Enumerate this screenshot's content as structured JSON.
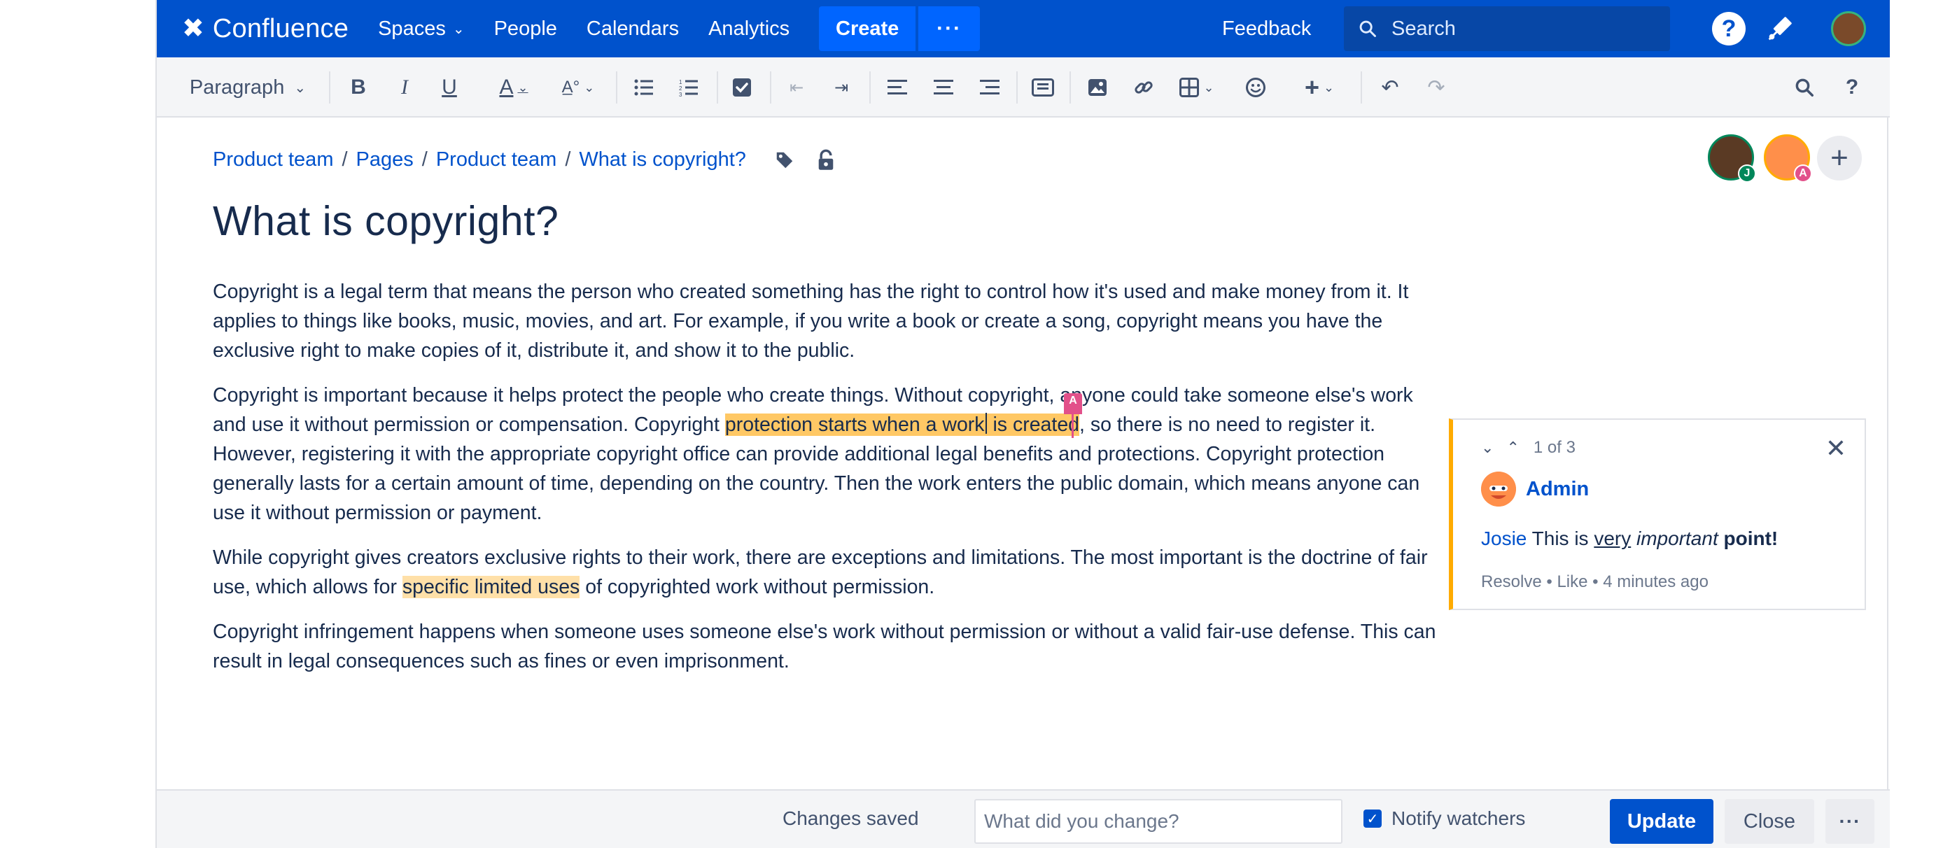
{
  "topnav": {
    "brand": "Confluence",
    "items": [
      {
        "label": "Spaces",
        "has_dropdown": true
      },
      {
        "label": "People"
      },
      {
        "label": "Calendars"
      },
      {
        "label": "Analytics"
      }
    ],
    "create_label": "Create",
    "more_label": "···",
    "feedback_label": "Feedback",
    "search_placeholder": "Search",
    "help_label": "?",
    "brand_color": "#0052cc"
  },
  "toolbar": {
    "paragraph_style": "Paragraph",
    "bold": "B",
    "italic": "I",
    "underline": "U",
    "text_color": "A",
    "icons": [
      "text-style",
      "bullet-list",
      "numbered-list",
      "task-list",
      "outdent",
      "indent",
      "align-left",
      "align-center",
      "align-right",
      "page-layout",
      "image",
      "link",
      "table",
      "emoji",
      "insert-more",
      "undo",
      "redo",
      "find",
      "help"
    ]
  },
  "breadcrumb": [
    "Product team",
    "Pages",
    "Product team",
    "What is copyright?"
  ],
  "collaborators": [
    {
      "initial": "J",
      "badge_color": "#00875a",
      "avatar_color": "#5a3a24"
    },
    {
      "initial": "A",
      "badge_color": "#e2508a",
      "avatar_color": "#ff8f4a"
    }
  ],
  "page": {
    "title": "What is copyright?",
    "paragraphs": {
      "p1": "Copyright is a legal term that means the person who created something has the right to control how it's used and make money from it. It applies to things like books, music, movies, and art. For example, if you write a book or create a song, copyright means you have the exclusive right to make copies of it, distribute it, and show it to the public.",
      "p2_before": "Copyright is important because it helps protect the people who create things. Without copyright, anyone could take someone else's work and use it without permission or compensation. Copyright ",
      "p2_highlight_a": "protection starts when a work",
      "p2_highlight_b": " is created",
      "p2_after": ", so there is no need to register it. However, registering it with the appropriate copyright office can provide additional legal benefits and protections. Copyright protection generally lasts for a certain amount of time, depending on the country. Then the work enters the public domain, which means anyone can use it without permission or payment.",
      "p3_before": "While copyright gives creators exclusive rights to their work, there are exceptions and limitations. The most important is the doctrine of fair use, which allows for ",
      "p3_highlight": "specific limited uses",
      "p3_after": " of copyrighted work without permission.",
      "p4": "Copyright infringement happens when someone uses someone else's work without permission or without a valid fair-use defense. This can result in legal consequences such as fines or even imprisonment."
    },
    "cursor_marker": "A"
  },
  "comment": {
    "counter": "1 of 3",
    "author": "Admin",
    "mention": "Josie",
    "text_plain": " This is ",
    "text_underlined": "very",
    "text_italic": " important",
    "text_bold": " point!",
    "meta": "Resolve • Like • 4 minutes ago",
    "accent_color": "#ffab00"
  },
  "bottombar": {
    "status": "Changes saved",
    "change_placeholder": "What did you change?",
    "notify_label": "Notify watchers",
    "notify_checked": true,
    "update_label": "Update",
    "close_label": "Close",
    "more_label": "···"
  }
}
